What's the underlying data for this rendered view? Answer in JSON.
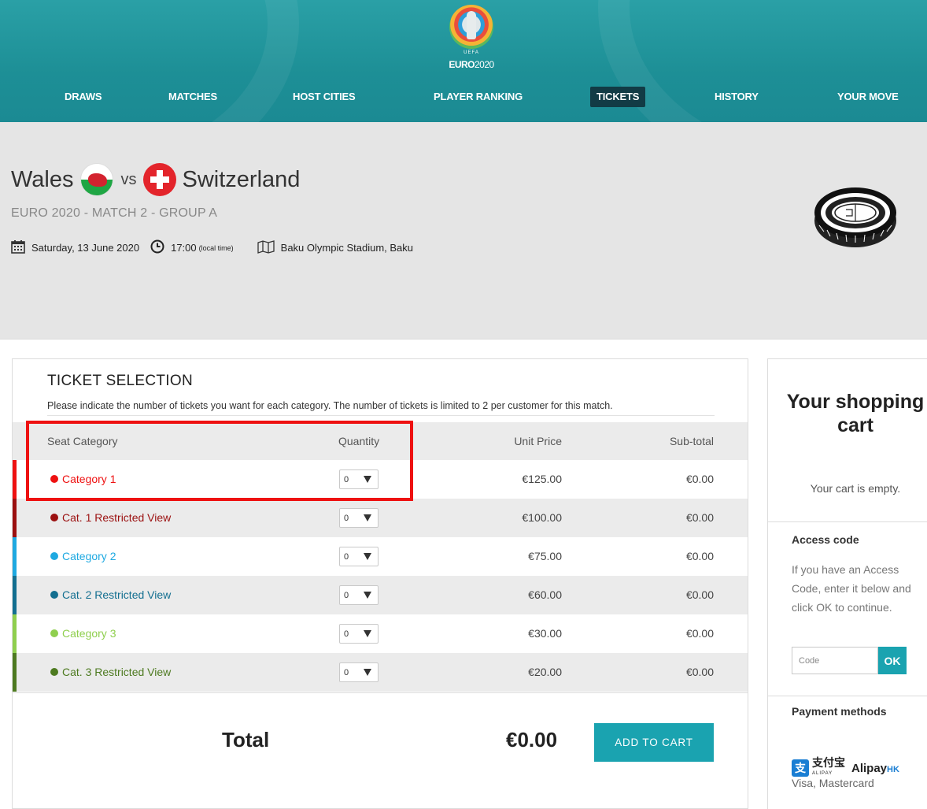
{
  "colors": {
    "header_bg": "#1d8f96",
    "nav_active_bg": "#123b45",
    "accent_button": "#1aa3b0",
    "highlight_box": "#ee1111"
  },
  "logo": {
    "uefa": "UEFA",
    "brand_bold": "EURO",
    "brand_thin": "2020"
  },
  "nav": {
    "items": [
      {
        "label": "DRAWS"
      },
      {
        "label": "MATCHES"
      },
      {
        "label": "HOST CITIES"
      },
      {
        "label": "PLAYER RANKING"
      },
      {
        "label": "TICKETS",
        "active": true
      },
      {
        "label": "HISTORY"
      },
      {
        "label": "YOUR MOVE"
      }
    ]
  },
  "match": {
    "home_team": "Wales",
    "vs": "vs",
    "away_team": "Switzerland",
    "subtitle": "EURO 2020  - MATCH 2 - GROUP A",
    "date": "Saturday, 13 June 2020",
    "time": "17:00",
    "time_note": "(local time)",
    "venue": "Baku Olympic Stadium, Baku"
  },
  "ticket_selection": {
    "title": "TICKET SELECTION",
    "description": "Please indicate the number of tickets you want for each category. The number of tickets is limited to 2 per customer for this match.",
    "headers": {
      "category": "Seat Category",
      "quantity": "Quantity",
      "unit_price": "Unit Price",
      "subtotal": "Sub-total"
    },
    "rows": [
      {
        "category": "Category 1",
        "color": "#ee1111",
        "quantity": "0",
        "unit_price": "€125.00",
        "subtotal": "€0.00"
      },
      {
        "category": "Cat. 1 Restricted View",
        "color": "#9b1010",
        "quantity": "0",
        "unit_price": "€100.00",
        "subtotal": "€0.00"
      },
      {
        "category": "Category 2",
        "color": "#1ea9e1",
        "quantity": "0",
        "unit_price": "€75.00",
        "subtotal": "€0.00"
      },
      {
        "category": "Cat. 2 Restricted View",
        "color": "#136f90",
        "quantity": "0",
        "unit_price": "€60.00",
        "subtotal": "€0.00"
      },
      {
        "category": "Category 3",
        "color": "#8fcf4e",
        "quantity": "0",
        "unit_price": "€30.00",
        "subtotal": "€0.00"
      },
      {
        "category": "Cat. 3 Restricted View",
        "color": "#4d7a20",
        "quantity": "0",
        "unit_price": "€20.00",
        "subtotal": "€0.00"
      }
    ],
    "total_label": "Total",
    "total_value": "€0.00",
    "add_to_cart": "ADD TO CART"
  },
  "cart": {
    "title": "Your shopping cart",
    "empty_text": "Your cart is empty.",
    "access_code_heading": "Access code",
    "access_code_text": "If you have an Access Code, enter it below and click OK to continue.",
    "code_placeholder": "Code",
    "ok_label": "OK",
    "payment_heading": "Payment methods",
    "alipay_cn": "支付宝",
    "alipay_cn_sub": "ALIPAY",
    "alipay_en": "Alipay",
    "alipay_hk": "HK",
    "cards": "Visa, Mastercard"
  }
}
